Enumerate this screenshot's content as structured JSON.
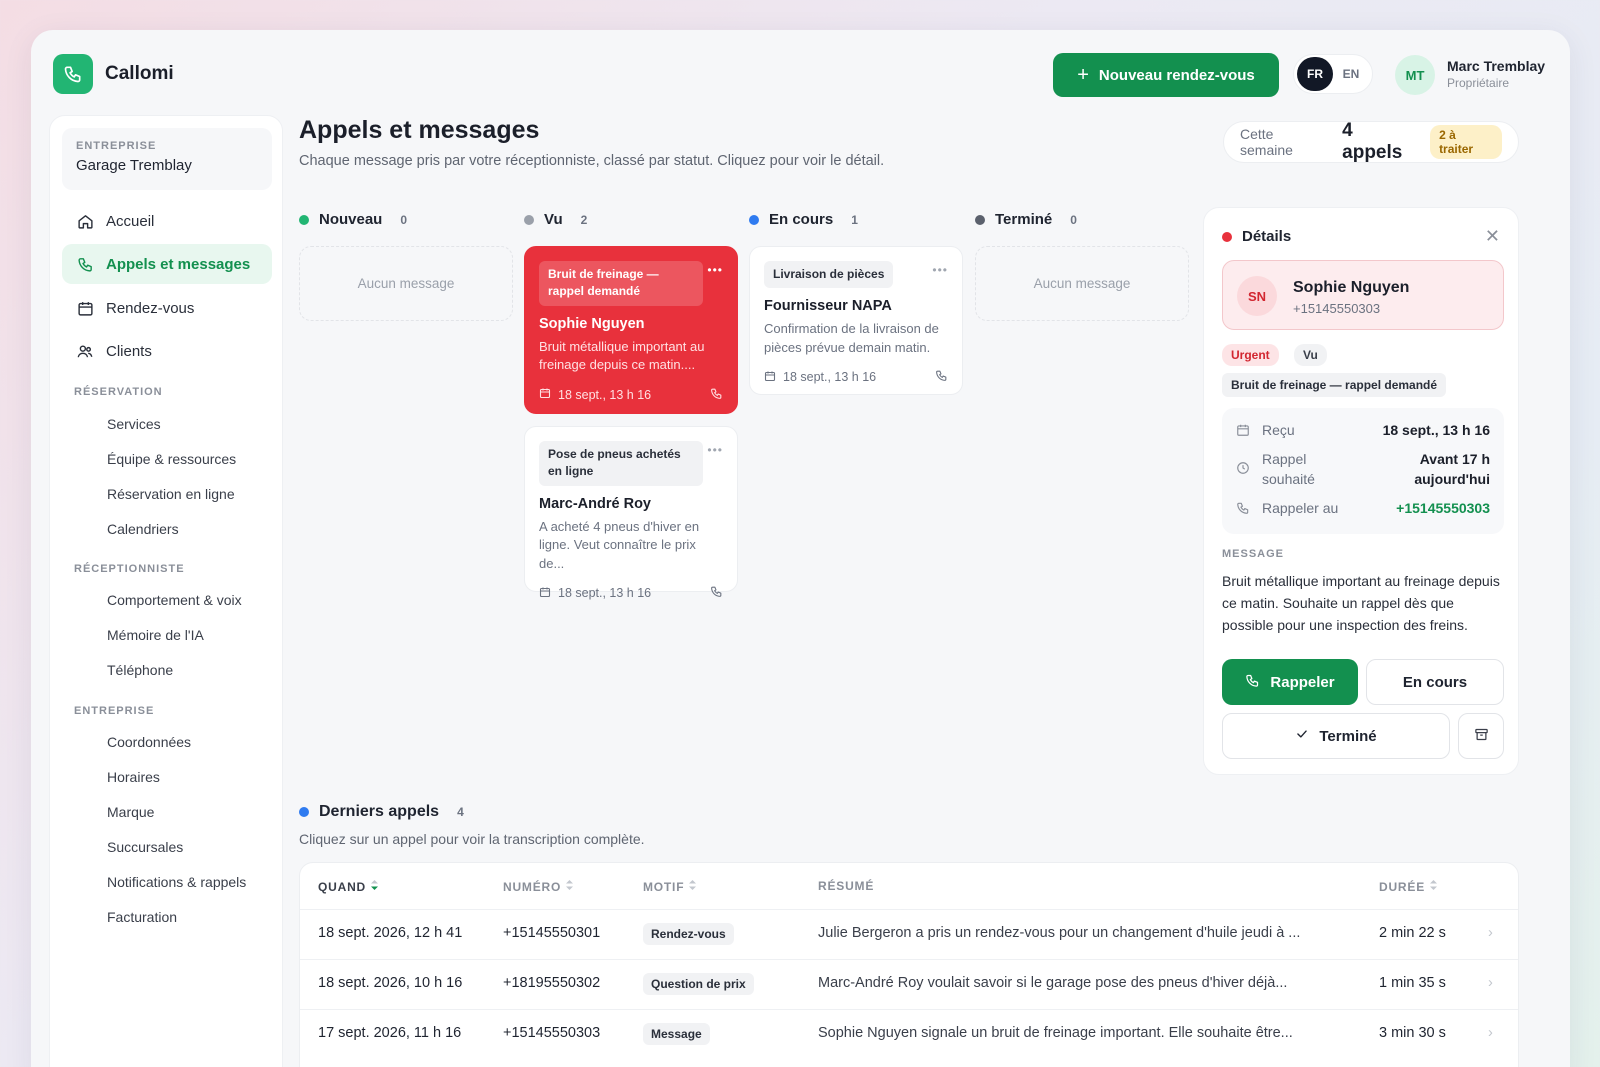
{
  "app": {
    "name": "Callomi"
  },
  "header": {
    "new_appointment_label": "Nouveau rendez-vous",
    "languages": [
      "FR",
      "EN"
    ],
    "active_language": "FR",
    "user": {
      "initials": "MT",
      "name": "Marc Tremblay",
      "role": "Propriétaire"
    }
  },
  "sidebar": {
    "business_label": "ENTREPRISE",
    "business_name": "Garage Tremblay",
    "nav": [
      {
        "label": "Accueil",
        "icon": "home-icon"
      },
      {
        "label": "Appels et messages",
        "icon": "phone-icon",
        "active": true
      },
      {
        "label": "Rendez-vous",
        "icon": "calendar-icon"
      },
      {
        "label": "Clients",
        "icon": "users-icon"
      }
    ],
    "sections": [
      {
        "title": "RÉSERVATION",
        "items": [
          "Services",
          "Équipe & ressources",
          "Réservation en ligne",
          "Calendriers"
        ]
      },
      {
        "title": "RÉCEPTIONNISTE",
        "items": [
          "Comportement & voix",
          "Mémoire de l'IA",
          "Téléphone"
        ]
      },
      {
        "title": "ENTREPRISE",
        "items": [
          "Coordonnées",
          "Horaires",
          "Marque",
          "Succursales",
          "Notifications & rappels",
          "Facturation"
        ]
      }
    ]
  },
  "page": {
    "title": "Appels et messages",
    "subtitle": "Chaque message pris par votre réceptionniste, classé par statut. Cliquez pour voir le détail.",
    "week": {
      "label": "Cette semaine",
      "count": "4 appels",
      "badge": "2 à traiter"
    }
  },
  "board": {
    "empty_label": "Aucun message",
    "columns": [
      {
        "name": "Nouveau",
        "count": "0",
        "color": "#22b573"
      },
      {
        "name": "Vu",
        "count": "2",
        "color": "#9aa0aa"
      },
      {
        "name": "En cours",
        "count": "1",
        "color": "#2f7bf0"
      },
      {
        "name": "Terminé",
        "count": "0",
        "color": "#5b616d"
      }
    ],
    "cards": {
      "vu": [
        {
          "tag": "Bruit de freinage — rappel demandé",
          "name": "Sophie Nguyen",
          "desc": "Bruit métallique important au freinage depuis ce matin....",
          "date": "18 sept., 13 h 16",
          "urgent": true
        },
        {
          "tag": "Pose de pneus achetés en ligne",
          "name": "Marc-André Roy",
          "desc": "A acheté 4 pneus d'hiver en ligne. Veut connaître le prix de...",
          "date": "18 sept., 13 h 16",
          "urgent": false
        }
      ],
      "en_cours": [
        {
          "tag": "Livraison de pièces",
          "name": "Fournisseur NAPA",
          "desc": "Confirmation de la livraison de pièces prévue demain matin.",
          "date": "18 sept., 13 h 16",
          "urgent": false
        }
      ]
    }
  },
  "details": {
    "title": "Détails",
    "contact": {
      "initials": "SN",
      "name": "Sophie Nguyen",
      "phone": "+15145550303"
    },
    "pills": [
      "Urgent",
      "Vu"
    ],
    "reason": "Bruit de freinage — rappel demandé",
    "info": {
      "received_label": "Reçu",
      "received_value": "18 sept., 13 h 16",
      "callback_label_1": "Rappel",
      "callback_label_2": "souhaité",
      "callback_value_1": "Avant 17 h",
      "callback_value_2": "aujourd'hui",
      "callback_at_label": "Rappeler au",
      "callback_at_value": "+15145550303"
    },
    "message_label": "MESSAGE",
    "message": "Bruit métallique important au freinage depuis ce matin. Souhaite un rappel dès que possible pour une inspection des freins.",
    "actions": {
      "call": "Rappeler",
      "in_progress": "En cours",
      "done": "Terminé"
    }
  },
  "recent": {
    "title": "Derniers appels",
    "count": "4",
    "subtitle": "Cliquez sur un appel pour voir la transcription complète.",
    "headers": {
      "when": "QUAND",
      "number": "NUMÉRO",
      "reason": "MOTIF",
      "summary": "RÉSUMÉ",
      "duration": "DURÉE"
    },
    "rows": [
      {
        "when": "18 sept. 2026, 12 h 41",
        "number": "+15145550301",
        "reason": "Rendez-vous",
        "summary": "Julie Bergeron a pris un rendez-vous pour un changement d'huile jeudi à ...",
        "duration": "2 min 22 s"
      },
      {
        "when": "18 sept. 2026, 10 h 16",
        "number": "+18195550302",
        "reason": "Question de prix",
        "summary": "Marc-André Roy voulait savoir si le garage pose des pneus d'hiver déjà...",
        "duration": "1 min 35 s"
      },
      {
        "when": "17 sept. 2026, 11 h 16",
        "number": "+15145550303",
        "reason": "Message",
        "summary": "Sophie Nguyen signale un bruit de freinage important. Elle souhaite être...",
        "duration": "3 min 30 s"
      }
    ]
  }
}
